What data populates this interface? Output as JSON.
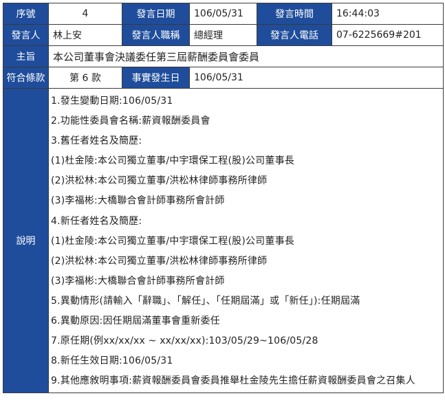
{
  "row1": {
    "seq_label": "序號",
    "seq_value": "4",
    "date_label": "發言日期",
    "date_value": "106/05/31",
    "time_label": "發言時間",
    "time_value": "16:44:03"
  },
  "row2": {
    "speaker_label": "發言人",
    "speaker_value": "林上安",
    "title_label": "發言人職稱",
    "title_value": "總經理",
    "phone_label": "發言人電話",
    "phone_value": "07-6225669#201"
  },
  "row3": {
    "subject_label": "主旨",
    "subject_value": "本公司董事會決議委任第三屆薪酬委員會委員"
  },
  "row4": {
    "clause_label": "符合條款",
    "clause_value": "第 6 款",
    "event_date_label": "事實發生日",
    "event_date_value": "106/05/31"
  },
  "description": {
    "label": "說明",
    "lines": [
      "1.發生變動日期:106/05/31",
      "2.功能性委員會名稱:薪資報酬委員會",
      "3.舊任者姓名及簡歷:",
      "(1)杜金陵:本公司獨立董事/中宇環保工程(股)公司董事長",
      "(2)洪松林:本公司獨立董事/洪松林律師事務所律師",
      "(3)李福彬:大橋聯合會計師事務所會計師",
      "4.新任者姓名及簡歷:",
      "(1)杜金陵:本公司獨立董事/中宇環保工程(股)公司董事長",
      "(2)洪松林:本公司獨立董事/洪松林律師事務所律師",
      "(3)李福彬:大橋聯合會計師事務所會計師",
      "5.異動情形(請輸入「辭職」、「解任」、「任期屆滿」或「新任」):任期屆滿",
      "6.異動原因:因任期屆滿董事會重新委任",
      "7.原任期(例xx/xx/xx ~ xx/xx/xx):103/05/29~106/05/28",
      "8.新任生效日期:106/05/31",
      "9.其他應敘明事項:薪資報酬委員會委員推舉杜金陵先生擔任薪資報酬委員會之召集人"
    ]
  },
  "colors": {
    "header_bg": "#1f4d9b",
    "header_text": "#ffffff",
    "border": "#3a3a3a"
  }
}
